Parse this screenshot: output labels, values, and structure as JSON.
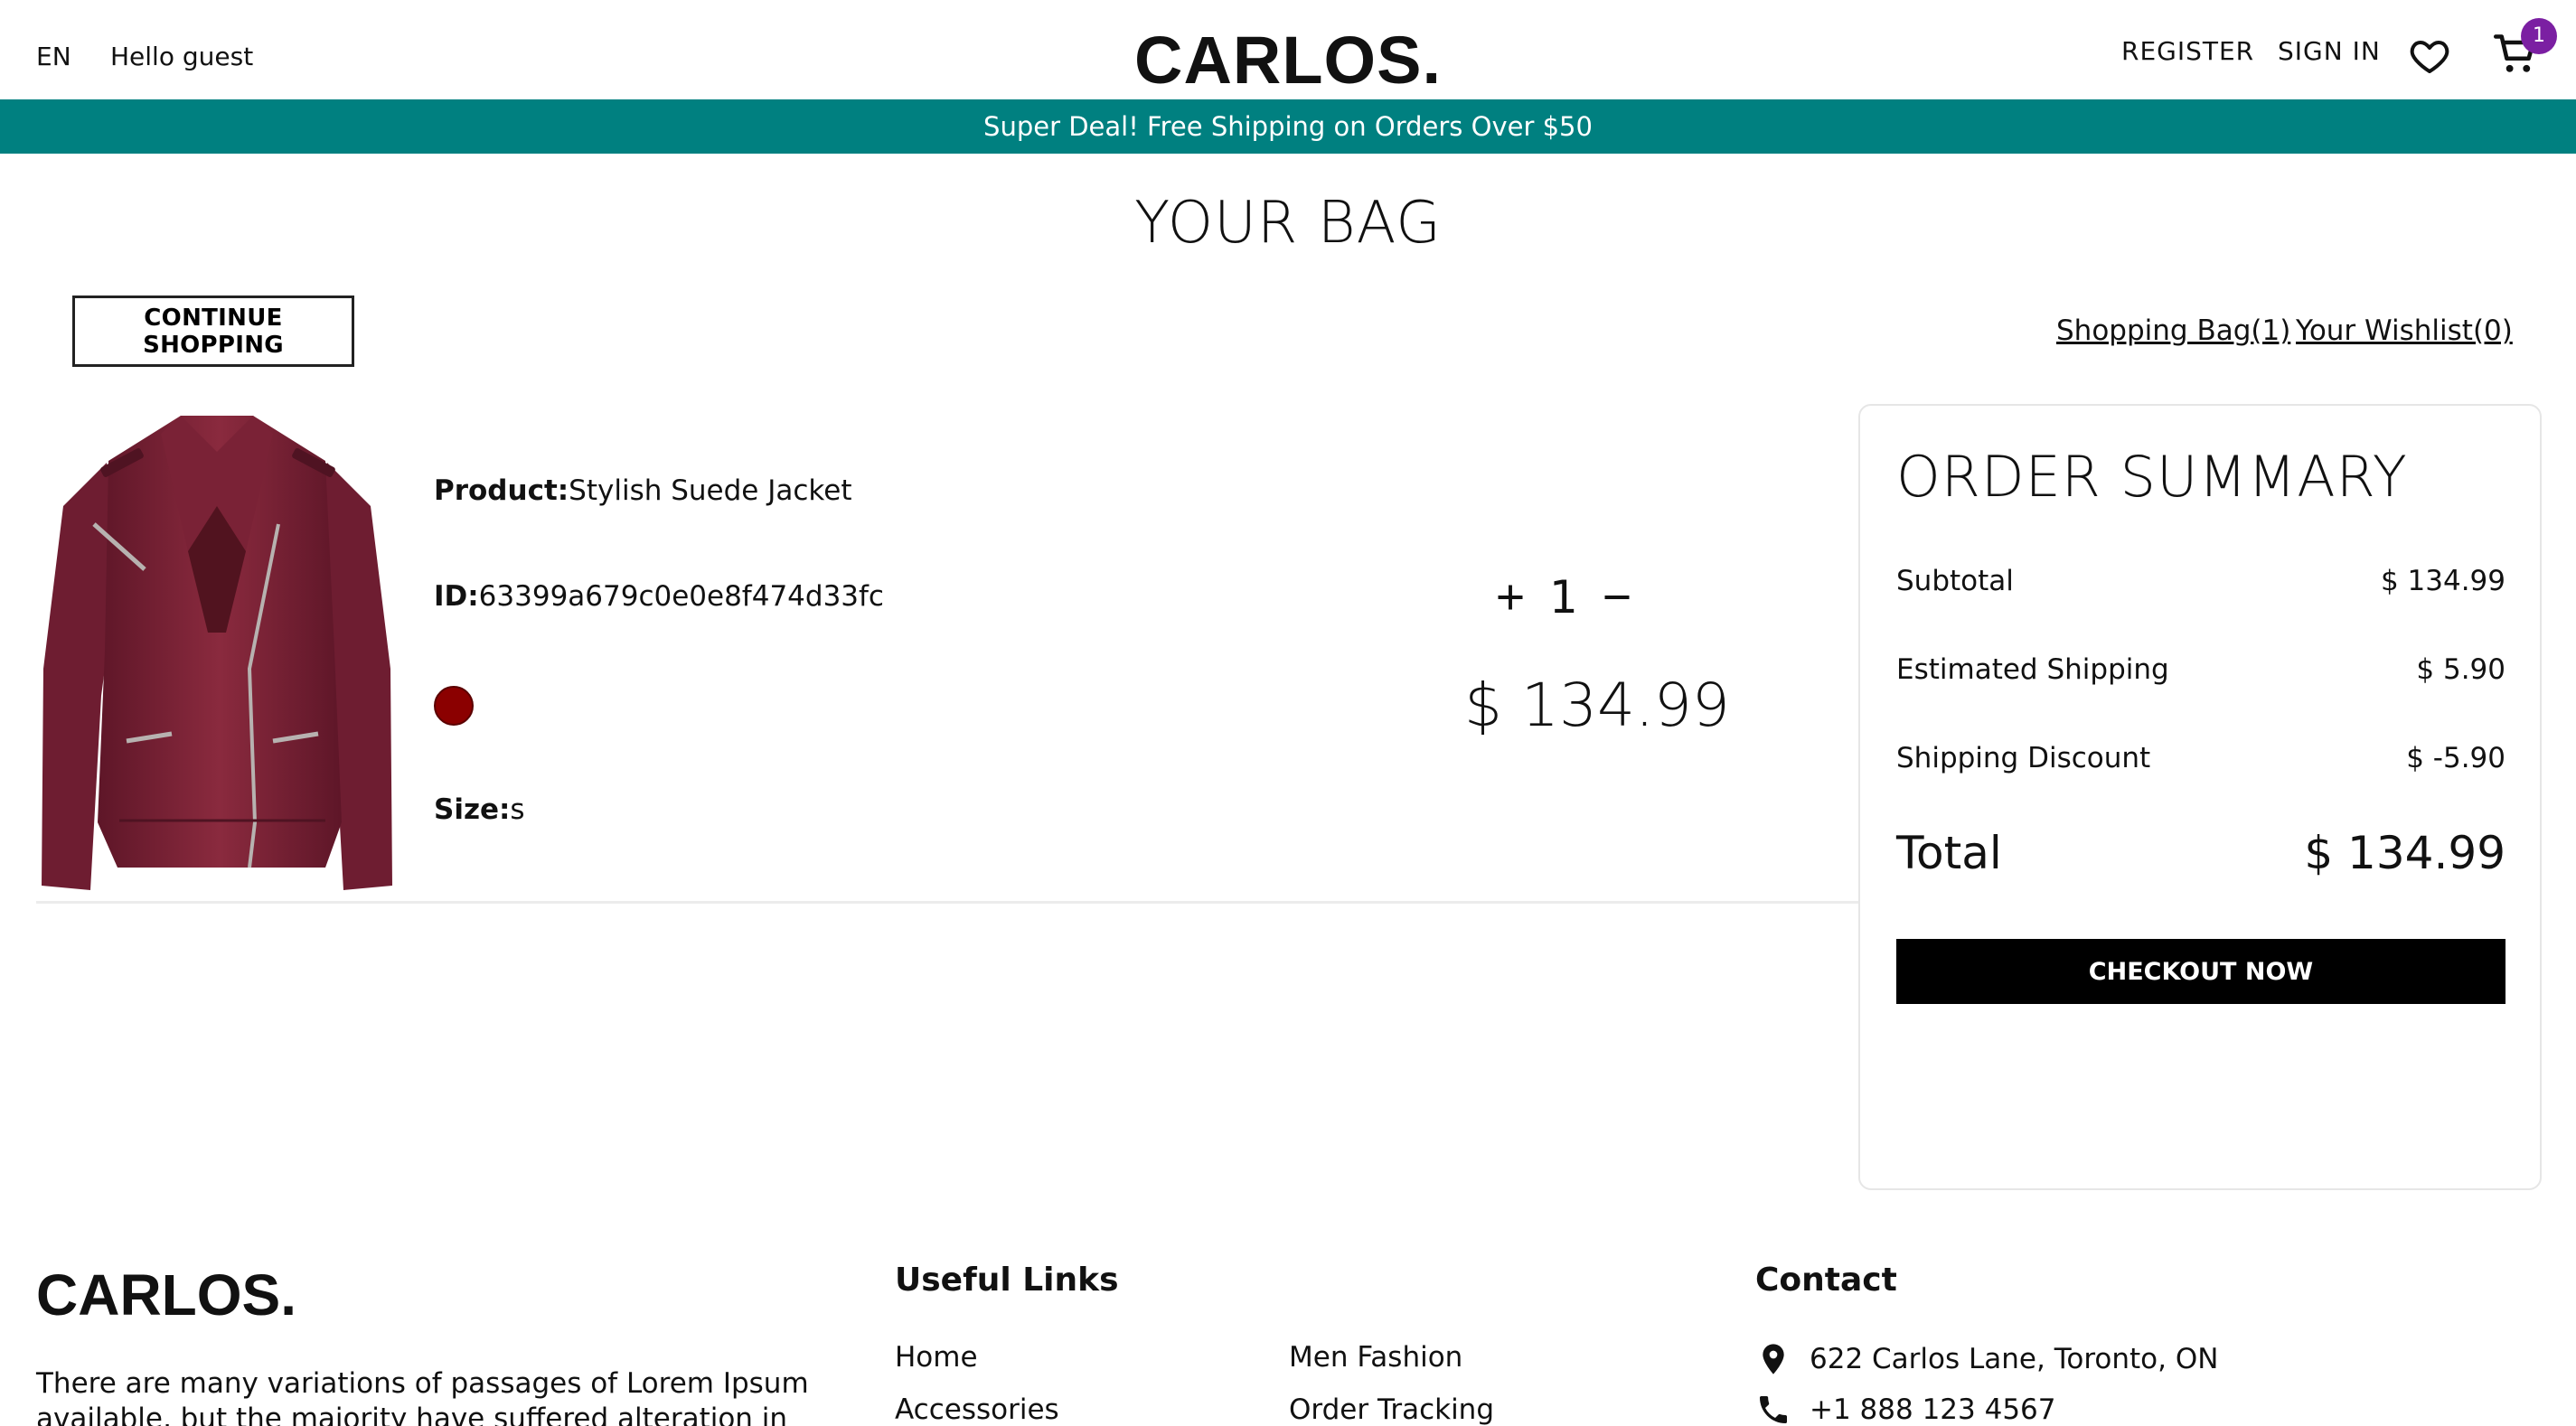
{
  "header": {
    "lang": "EN",
    "greeting": "Hello guest",
    "logo": "CARLOS.",
    "register": "REGISTER",
    "sign_in": "SIGN IN",
    "wishlist_icon": "heart-icon",
    "cart_icon": "cart-icon",
    "cart_count": "1",
    "badge_color": "#7b1fa2"
  },
  "promo": {
    "text": "Super Deal! Free Shipping on Orders Over $50",
    "color": "#008080"
  },
  "bag": {
    "title": "YOUR BAG",
    "continue_label": "CONTINUE SHOPPING",
    "shopping_bag_link": "Shopping Bag(1)",
    "wishlist_link": "Your Wishlist(0)"
  },
  "item": {
    "product_label": "Product:",
    "product_name": "Stylish Suede Jacket",
    "id_label": "ID:",
    "id": "63399a679c0e0e8f474d33fc",
    "color": "#8b0000",
    "size_label": "Size:",
    "size": "s",
    "quantity": "1",
    "price": "$ 134.99"
  },
  "summary": {
    "title": "ORDER SUMMARY",
    "rows": [
      {
        "label": "Subtotal",
        "value": "$ 134.99"
      },
      {
        "label": "Estimated Shipping",
        "value": "$ 5.90"
      },
      {
        "label": "Shipping Discount",
        "value": "$ -5.90"
      }
    ],
    "total_label": "Total",
    "total_value": "$ 134.99",
    "checkout_label": "CHECKOUT NOW"
  },
  "footer": {
    "logo": "CARLOS.",
    "description": "There are many variations of passages of Lorem Ipsum available, but the majority have suffered alteration in some form, by injected humour",
    "useful_links_title": "Useful Links",
    "links_col1": [
      "Home",
      "Accessories"
    ],
    "links_col2": [
      "Men Fashion",
      "Order Tracking"
    ],
    "contact_title": "Contact",
    "address": "622 Carlos Lane, Toronto, ON",
    "phone": "+1 888 123 4567",
    "address_icon": "location-pin-icon",
    "phone_icon": "phone-icon"
  }
}
